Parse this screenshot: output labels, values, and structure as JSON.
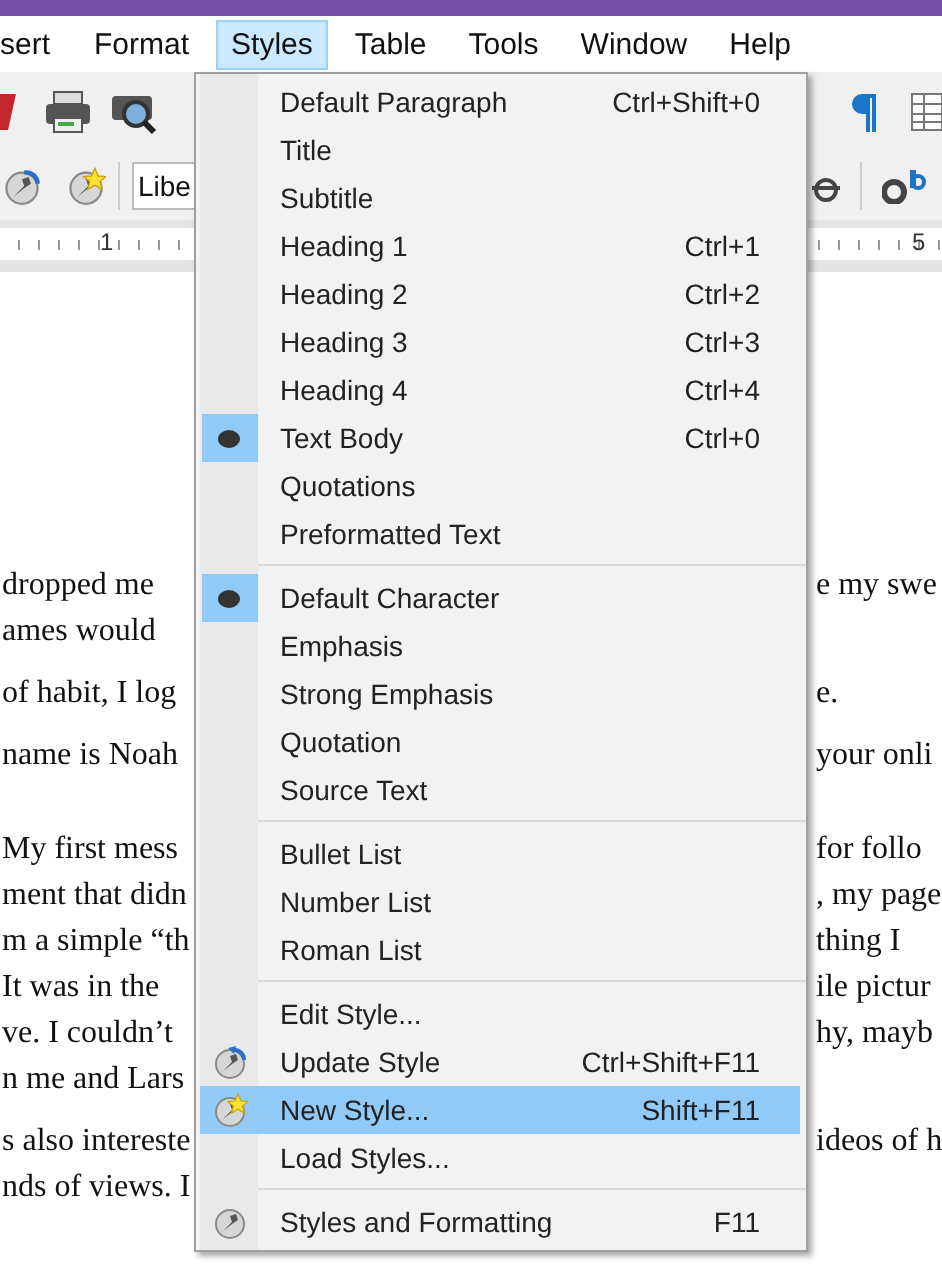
{
  "menubar": [
    {
      "label": "sert",
      "selected": false
    },
    {
      "label": "Format",
      "selected": false
    },
    {
      "label": "Styles",
      "selected": true
    },
    {
      "label": "Table",
      "selected": false
    },
    {
      "label": "Tools",
      "selected": false
    },
    {
      "label": "Window",
      "selected": false
    },
    {
      "label": "Help",
      "selected": false
    }
  ],
  "font_field": {
    "value": "Libe"
  },
  "ruler": {
    "labels": [
      "1",
      "5"
    ]
  },
  "document": {
    "paragraphs": [
      {
        "lines": [
          {
            "left": "dropped me",
            "right": "e my swe"
          },
          {
            "left": "ames would"
          }
        ]
      },
      {
        "lines": [
          {
            "left": "of habit, I log",
            "right": "e."
          }
        ]
      },
      {
        "lines": [
          {
            "left": "name is Noah",
            "right": "your onli"
          }
        ]
      },
      {
        "lines": [
          {
            "left": "My first mess",
            "right": "for follo"
          },
          {
            "left": "ment that didn",
            "right": ", my page"
          },
          {
            "left": "m a simple “th",
            "right": "thing I"
          },
          {
            "left": "It was in the",
            "right": "ile pictur"
          },
          {
            "left": "ve. I couldn’t",
            "right": "hy, mayb"
          },
          {
            "left": "n me and Lars"
          }
        ]
      },
      {
        "lines": [
          {
            "left": "s also intereste",
            "right": "ideos of h"
          },
          {
            "left": "nds of views. I"
          }
        ]
      }
    ]
  },
  "styles_menu": {
    "sections": [
      {
        "items": [
          {
            "label": "Default Paragraph",
            "shortcut": "Ctrl+Shift+0",
            "kind": "plain",
            "checked": false,
            "selected": false
          },
          {
            "label": "Title",
            "kind": "plain",
            "checked": false,
            "selected": false
          },
          {
            "label": "Subtitle",
            "kind": "plain",
            "checked": false,
            "selected": false
          },
          {
            "label": "Heading 1",
            "shortcut": "Ctrl+1",
            "kind": "plain",
            "checked": false,
            "selected": false
          },
          {
            "label": "Heading 2",
            "shortcut": "Ctrl+2",
            "kind": "plain",
            "checked": false,
            "selected": false
          },
          {
            "label": "Heading 3",
            "shortcut": "Ctrl+3",
            "kind": "plain",
            "checked": false,
            "selected": false
          },
          {
            "label": "Heading 4",
            "shortcut": "Ctrl+4",
            "kind": "plain",
            "checked": false,
            "selected": false
          },
          {
            "label": "Text Body",
            "shortcut": "Ctrl+0",
            "kind": "plain",
            "checked": true,
            "selected": false
          },
          {
            "label": "Quotations",
            "kind": "plain",
            "checked": false,
            "selected": false
          },
          {
            "label": "Preformatted Text",
            "kind": "plain",
            "checked": false,
            "selected": false
          }
        ]
      },
      {
        "items": [
          {
            "label": "Default Character",
            "kind": "plain",
            "checked": true,
            "selected": false
          },
          {
            "label": "Emphasis",
            "kind": "plain",
            "checked": false,
            "selected": false
          },
          {
            "label": "Strong Emphasis",
            "kind": "plain",
            "checked": false,
            "selected": false
          },
          {
            "label": "Quotation",
            "kind": "plain",
            "checked": false,
            "selected": false
          },
          {
            "label": "Source Text",
            "kind": "plain",
            "checked": false,
            "selected": false
          }
        ]
      },
      {
        "items": [
          {
            "label": "Bullet List",
            "kind": "plain",
            "checked": false,
            "selected": false
          },
          {
            "label": "Number List",
            "kind": "plain",
            "checked": false,
            "selected": false
          },
          {
            "label": "Roman List",
            "kind": "plain",
            "checked": false,
            "selected": false
          }
        ]
      },
      {
        "items": [
          {
            "label": "Edit Style...",
            "kind": "plain",
            "checked": false,
            "selected": false
          },
          {
            "label": "Update Style",
            "shortcut": "Ctrl+Shift+F11",
            "kind": "refresh",
            "checked": false,
            "selected": false
          },
          {
            "label": "New Style...",
            "shortcut": "Shift+F11",
            "kind": "star",
            "checked": false,
            "selected": true
          },
          {
            "label": "Load Styles...",
            "kind": "plain",
            "checked": false,
            "selected": false
          }
        ]
      },
      {
        "items": [
          {
            "label": "Styles and Formatting",
            "shortcut": "F11",
            "kind": "wrench",
            "checked": false,
            "selected": false
          }
        ]
      }
    ]
  }
}
